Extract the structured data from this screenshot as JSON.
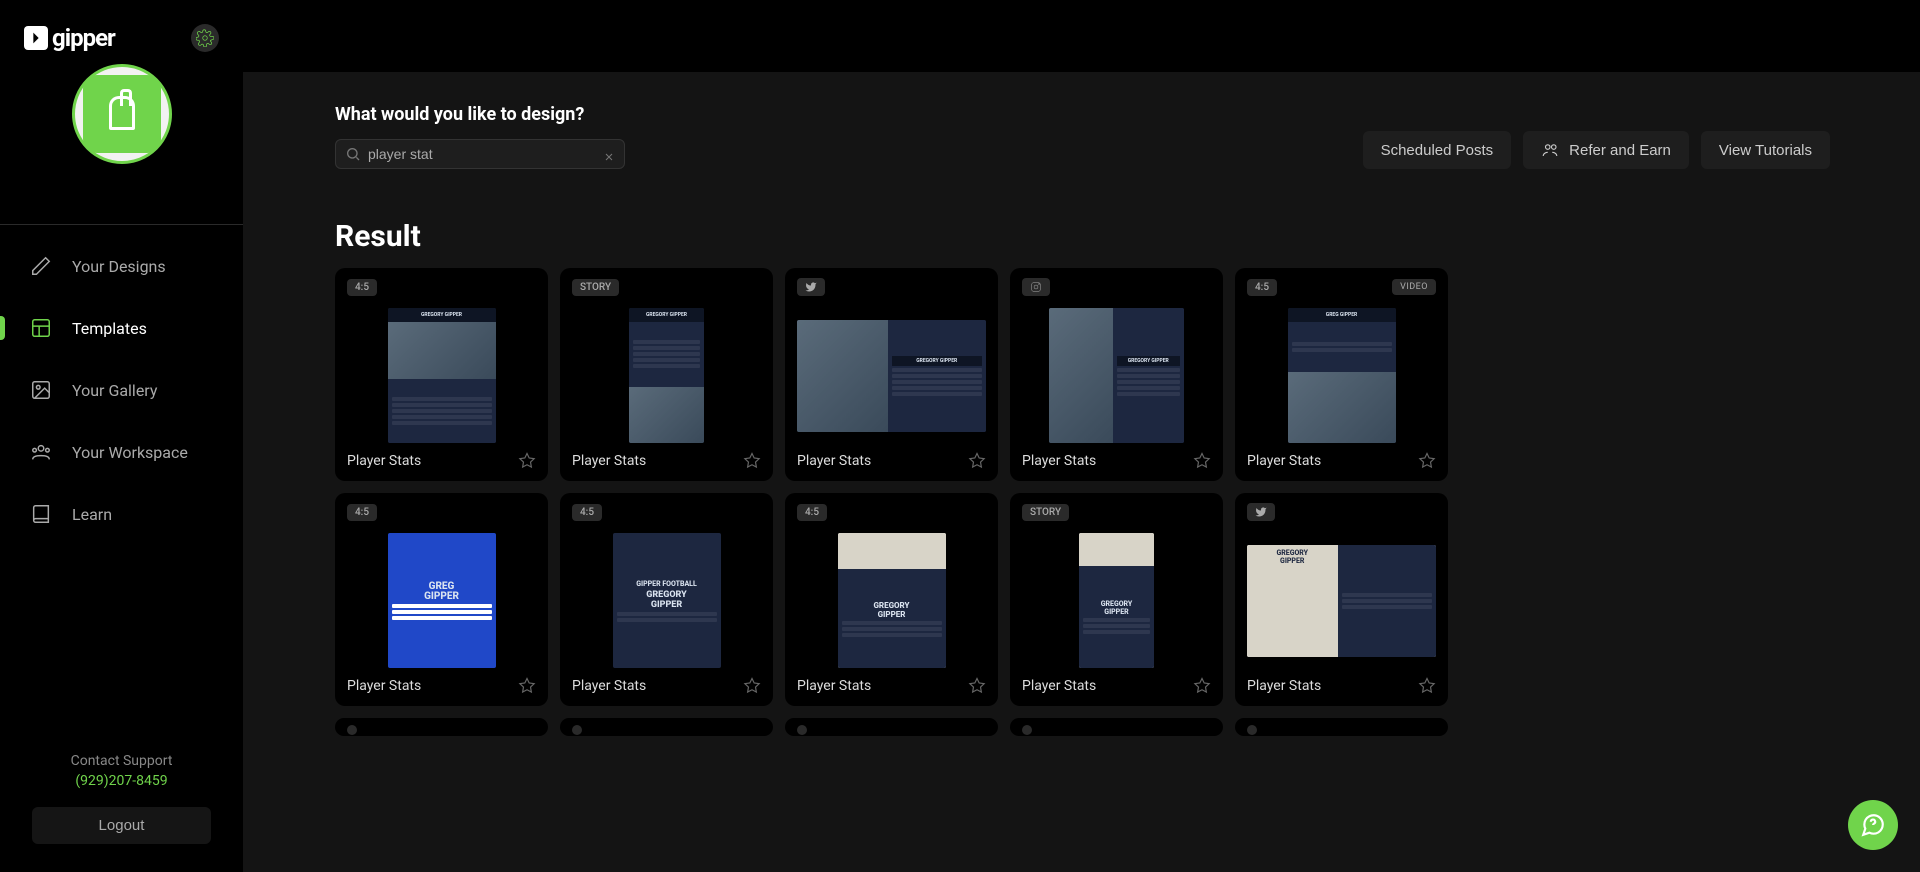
{
  "brand": {
    "name": "gipper"
  },
  "sidebar": {
    "nav": [
      {
        "label": "Your Designs"
      },
      {
        "label": "Templates"
      },
      {
        "label": "Your Gallery"
      },
      {
        "label": "Your Workspace"
      },
      {
        "label": "Learn"
      }
    ],
    "support_label": "Contact Support",
    "support_phone": "(929)207-8459",
    "logout": "Logout"
  },
  "header": {
    "prompt": "What would you like to design?",
    "search_value": "player stat",
    "buttons": {
      "scheduled": "Scheduled Posts",
      "refer": "Refer and Earn",
      "tutorials": "View Tutorials"
    }
  },
  "results": {
    "heading": "Result",
    "cards": [
      {
        "format": "4:5",
        "title": "Player Stats",
        "video": false
      },
      {
        "format": "STORY",
        "title": "Player Stats",
        "video": false
      },
      {
        "format": "twitter",
        "title": "Player Stats",
        "video": false
      },
      {
        "format": "instagram",
        "title": "Player Stats",
        "video": false
      },
      {
        "format": "4:5",
        "title": "Player Stats",
        "video": true
      },
      {
        "format": "4:5",
        "title": "Player Stats",
        "video": false
      },
      {
        "format": "4:5",
        "title": "Player Stats",
        "video": false
      },
      {
        "format": "4:5",
        "title": "Player Stats",
        "video": false
      },
      {
        "format": "STORY",
        "title": "Player Stats",
        "video": false
      },
      {
        "format": "twitter",
        "title": "Player Stats",
        "video": false
      }
    ],
    "video_badge": "VIDEO"
  },
  "colors": {
    "accent": "#70d44b"
  }
}
